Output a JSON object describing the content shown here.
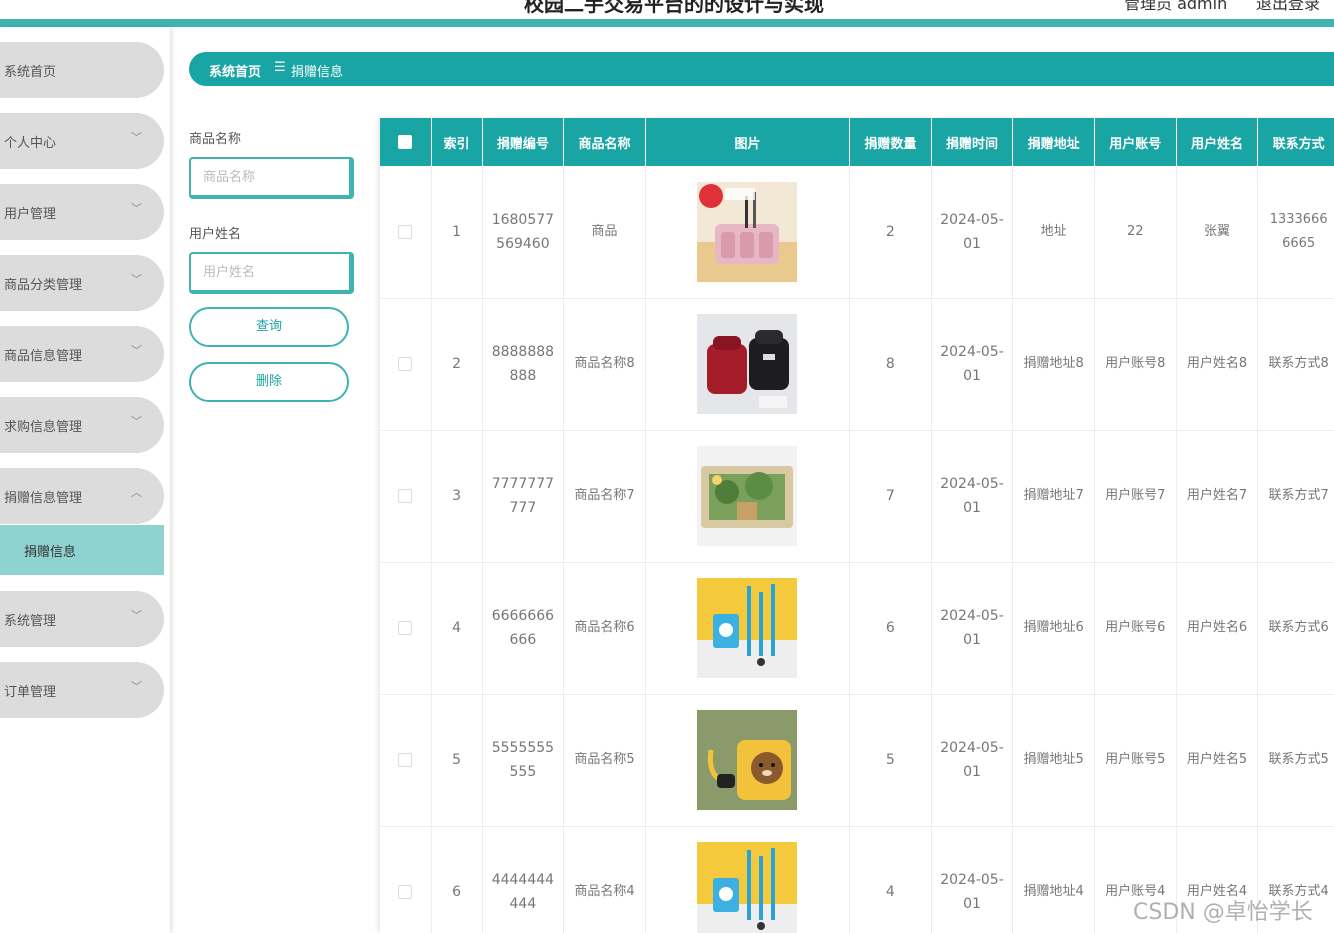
{
  "header": {
    "title": "校园二手交易平台的的设计与实现",
    "user_label": "管理员 admin",
    "logout_label": "退出登录"
  },
  "sidebar": {
    "items": [
      {
        "label": "系统首页",
        "has_chevron": false
      },
      {
        "label": "个人中心",
        "has_chevron": true
      },
      {
        "label": "用户管理",
        "has_chevron": true
      },
      {
        "label": "商品分类管理",
        "has_chevron": true
      },
      {
        "label": "商品信息管理",
        "has_chevron": true
      },
      {
        "label": "求购信息管理",
        "has_chevron": true
      },
      {
        "label": "捐赠信息管理",
        "has_chevron": true,
        "expanded": true
      },
      {
        "label": "系统管理",
        "has_chevron": true
      },
      {
        "label": "订单管理",
        "has_chevron": true
      }
    ],
    "submenu": {
      "label": "捐赠信息"
    }
  },
  "breadcrumb": {
    "home": "系统首页",
    "separator": "☰",
    "current": "捐赠信息"
  },
  "search": {
    "product_name_label": "商品名称",
    "product_name_placeholder": "商品名称",
    "user_name_label": "用户姓名",
    "user_name_placeholder": "用户姓名",
    "query_button": "查询",
    "delete_button": "删除"
  },
  "table": {
    "columns": [
      "索引",
      "捐赠编号",
      "商品名称",
      "图片",
      "捐赠数量",
      "捐赠时间",
      "捐赠地址",
      "用户账号",
      "用户姓名",
      "联系方式"
    ],
    "rows": [
      {
        "index": "1",
        "code": "1680577569460",
        "product": "商品",
        "qty": "2",
        "time": "2024-05-01",
        "address": "地址",
        "account": "22",
        "name": "张翼",
        "phone": "13336666665",
        "img": "pink"
      },
      {
        "index": "2",
        "code": "8888888888",
        "product": "商品名称8",
        "qty": "8",
        "time": "2024-05-01",
        "address": "捐赠地址8",
        "account": "用户账号8",
        "name": "用户姓名8",
        "phone": "联系方式8",
        "img": "bags"
      },
      {
        "index": "3",
        "code": "7777777777",
        "product": "商品名称7",
        "qty": "7",
        "time": "2024-05-01",
        "address": "捐赠地址7",
        "account": "用户账号7",
        "name": "用户姓名7",
        "phone": "联系方式7",
        "img": "forest"
      },
      {
        "index": "4",
        "code": "6666666666",
        "product": "商品名称6",
        "qty": "6",
        "time": "2024-05-01",
        "address": "捐赠地址6",
        "account": "用户账号6",
        "name": "用户姓名6",
        "phone": "联系方式6",
        "img": "lanyard"
      },
      {
        "index": "5",
        "code": "5555555555",
        "product": "商品名称5",
        "qty": "5",
        "time": "2024-05-01",
        "address": "捐赠地址5",
        "account": "用户账号5",
        "name": "用户姓名5",
        "phone": "联系方式5",
        "img": "bear"
      },
      {
        "index": "6",
        "code": "4444444444",
        "product": "商品名称4",
        "qty": "4",
        "time": "2024-05-01",
        "address": "捐赠地址4",
        "account": "用户账号4",
        "name": "用户姓名4",
        "phone": "联系方式4",
        "img": "lanyard"
      }
    ]
  },
  "watermark": "CSDN @卓怡学长",
  "colors": {
    "accent": "#1aa5a5",
    "accent_light": "#3fb3b0",
    "submenu_active": "#8fd3d1",
    "menu_bg": "#dcdcdc"
  }
}
